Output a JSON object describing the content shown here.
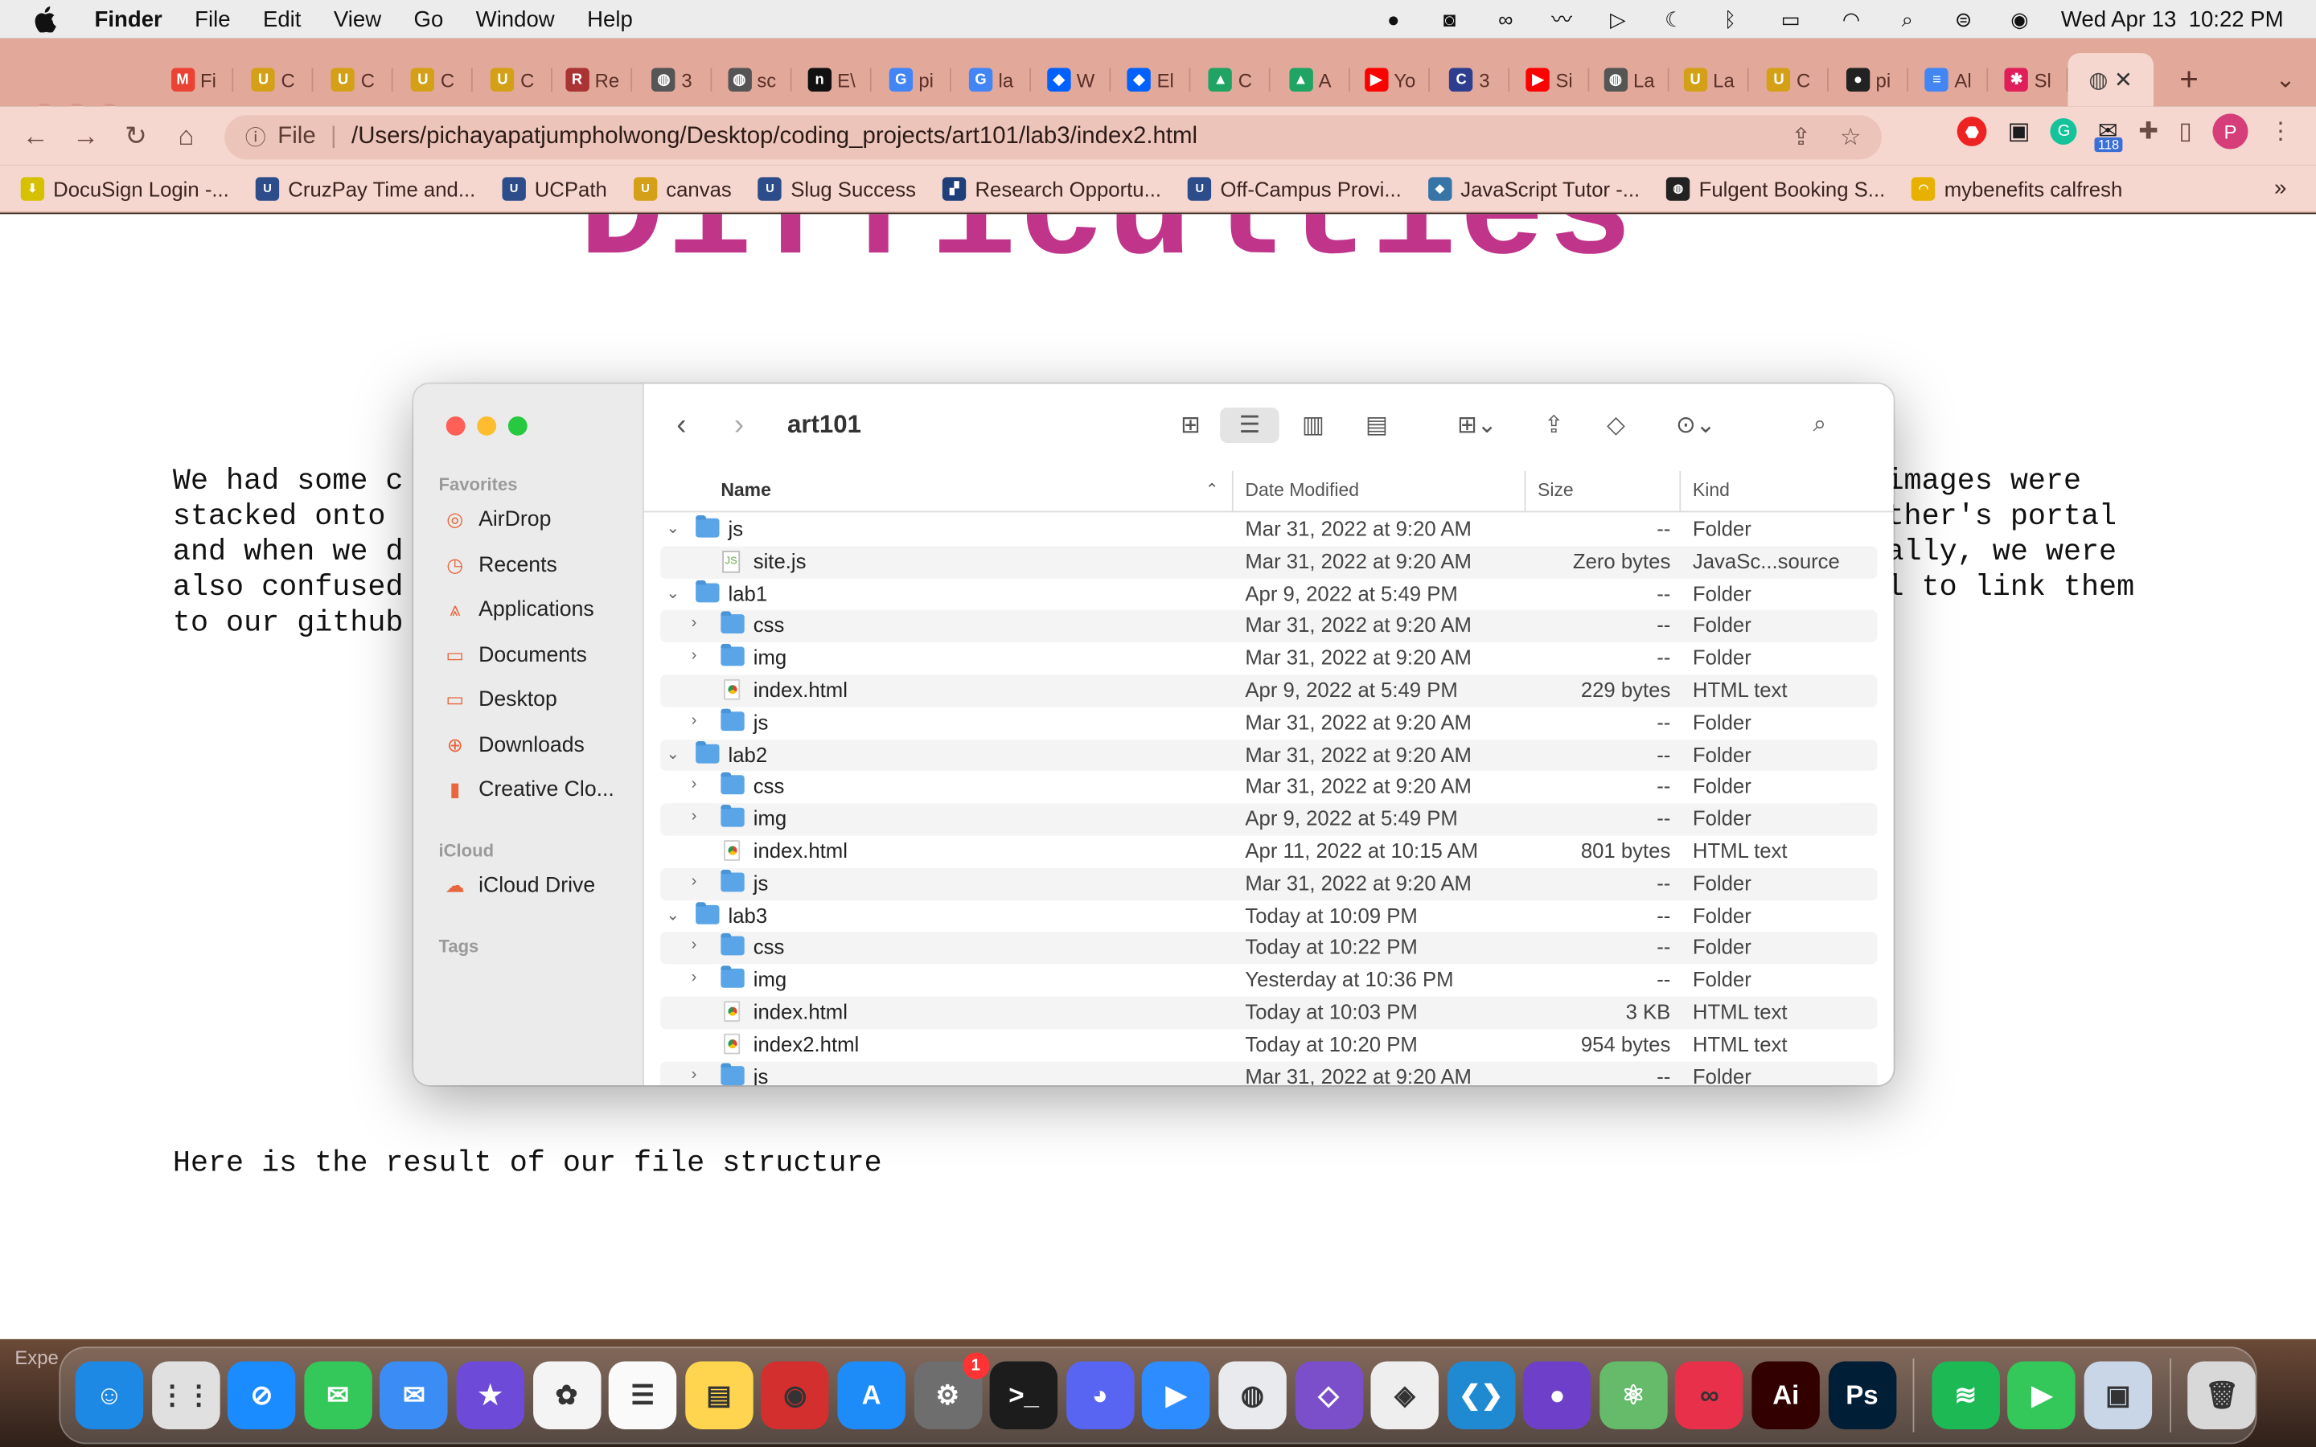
{
  "menubar": {
    "app_name": "Finder",
    "menus": [
      "File",
      "Edit",
      "View",
      "Go",
      "Window",
      "Help"
    ],
    "datetime": "Wed Apr 13  10:22 PM"
  },
  "browser": {
    "tabs": [
      {
        "fav": "M",
        "label": "Fi",
        "color": "#ea4335"
      },
      {
        "fav": "U",
        "label": "C",
        "color": "#d4a017"
      },
      {
        "fav": "U",
        "label": "C",
        "color": "#d4a017"
      },
      {
        "fav": "U",
        "label": "C",
        "color": "#d4a017"
      },
      {
        "fav": "U",
        "label": "C",
        "color": "#d4a017"
      },
      {
        "fav": "R",
        "label": "Re",
        "color": "#a33"
      },
      {
        "fav": "◍",
        "label": "3",
        "color": "#555"
      },
      {
        "fav": "◍",
        "label": "sc",
        "color": "#555"
      },
      {
        "fav": "n",
        "label": "E\\",
        "color": "#111"
      },
      {
        "fav": "G",
        "label": "pi",
        "color": "#4285f4"
      },
      {
        "fav": "G",
        "label": "la",
        "color": "#4285f4"
      },
      {
        "fav": "◆",
        "label": "W",
        "color": "#0061fe"
      },
      {
        "fav": "◆",
        "label": "El",
        "color": "#0061fe"
      },
      {
        "fav": "▲",
        "label": "C",
        "color": "#1fa463"
      },
      {
        "fav": "▲",
        "label": "A",
        "color": "#1fa463"
      },
      {
        "fav": "▶",
        "label": "Yo",
        "color": "#f00"
      },
      {
        "fav": "C",
        "label": "3",
        "color": "#2d3e8f"
      },
      {
        "fav": "▶",
        "label": "Si",
        "color": "#f00"
      },
      {
        "fav": "◍",
        "label": "La",
        "color": "#555"
      },
      {
        "fav": "U",
        "label": "La",
        "color": "#d4a017"
      },
      {
        "fav": "U",
        "label": "C",
        "color": "#d4a017"
      },
      {
        "fav": "●",
        "label": "pi",
        "color": "#222"
      },
      {
        "fav": "≡",
        "label": "Al",
        "color": "#4285f4"
      },
      {
        "fav": "✱",
        "label": "Sl",
        "color": "#e01e5a"
      }
    ],
    "active_tab_fav": "◍",
    "new_tab": "+",
    "url_scheme": "File",
    "url_path": "/Users/pichayapatjumpholwong/Desktop/coding_projects/art101/lab3/index2.html",
    "extension_badge": "118",
    "profile_initial": "P",
    "bookmarks": [
      {
        "label": "DocuSign Login -...",
        "color": "#d6c100",
        "fav": "⬇"
      },
      {
        "label": "CruzPay Time and...",
        "color": "#2d4d8a",
        "fav": "U"
      },
      {
        "label": "UCPath",
        "color": "#2d4d8a",
        "fav": "U"
      },
      {
        "label": "canvas",
        "color": "#d4a017",
        "fav": "U"
      },
      {
        "label": "Slug Success",
        "color": "#2d4d8a",
        "fav": "U"
      },
      {
        "label": "Research Opportu...",
        "color": "#1e3f7a",
        "fav": "▞"
      },
      {
        "label": "Off-Campus Provi...",
        "color": "#2d4d8a",
        "fav": "U"
      },
      {
        "label": "JavaScript Tutor -...",
        "color": "#3774a8",
        "fav": "◆"
      },
      {
        "label": "Fulgent Booking S...",
        "color": "#222",
        "fav": "◍"
      },
      {
        "label": "mybenefits calfresh",
        "color": "#e8b100",
        "fav": "◠"
      }
    ],
    "more": "»"
  },
  "page": {
    "title": "Difficulties",
    "paragraph_lines": [
      "We had some c",
      "stacked onto",
      "and when we d",
      "also confused",
      "to our github"
    ],
    "paragraph_right_lines": [
      "images were",
      "ther's portal",
      "ally, we were",
      "l to link them"
    ],
    "result_text": "Here is the result of our file structure"
  },
  "finder": {
    "title": "art101",
    "sidebar": {
      "favorites_label": "Favorites",
      "favorites": [
        {
          "label": "AirDrop",
          "icon": "airdrop-icon",
          "glyph": "◎"
        },
        {
          "label": "Recents",
          "icon": "clock-icon",
          "glyph": "◷"
        },
        {
          "label": "Applications",
          "icon": "applications-icon",
          "glyph": "⩓"
        },
        {
          "label": "Documents",
          "icon": "document-icon",
          "glyph": "▭"
        },
        {
          "label": "Desktop",
          "icon": "desktop-icon",
          "glyph": "▭"
        },
        {
          "label": "Downloads",
          "icon": "download-icon",
          "glyph": "⊕"
        },
        {
          "label": "Creative Clo...",
          "icon": "file-icon",
          "glyph": "▮"
        }
      ],
      "icloud_label": "iCloud",
      "icloud": [
        {
          "label": "iCloud Drive",
          "icon": "cloud-icon",
          "glyph": "☁"
        }
      ],
      "tags_label": "Tags"
    },
    "columns": {
      "name": "Name",
      "date": "Date Modified",
      "size": "Size",
      "kind": "Kind"
    },
    "rows": [
      {
        "depth": 0,
        "disc": "⌄",
        "type": "folder",
        "name": "js",
        "date": "Mar 31, 2022 at 9:20 AM",
        "size": "--",
        "kind": "Folder"
      },
      {
        "depth": 1,
        "disc": "",
        "type": "js",
        "name": "site.js",
        "date": "Mar 31, 2022 at 9:20 AM",
        "size": "Zero bytes",
        "kind": "JavaSc...source"
      },
      {
        "depth": 0,
        "disc": "⌄",
        "type": "folder",
        "name": "lab1",
        "date": "Apr 9, 2022 at 5:49 PM",
        "size": "--",
        "kind": "Folder"
      },
      {
        "depth": 1,
        "disc": "›",
        "type": "folder",
        "name": "css",
        "date": "Mar 31, 2022 at 9:20 AM",
        "size": "--",
        "kind": "Folder"
      },
      {
        "depth": 1,
        "disc": "›",
        "type": "folder",
        "name": "img",
        "date": "Mar 31, 2022 at 9:20 AM",
        "size": "--",
        "kind": "Folder"
      },
      {
        "depth": 1,
        "disc": "",
        "type": "html",
        "name": "index.html",
        "date": "Apr 9, 2022 at 5:49 PM",
        "size": "229 bytes",
        "kind": "HTML text"
      },
      {
        "depth": 1,
        "disc": "›",
        "type": "folder",
        "name": "js",
        "date": "Mar 31, 2022 at 9:20 AM",
        "size": "--",
        "kind": "Folder"
      },
      {
        "depth": 0,
        "disc": "⌄",
        "type": "folder",
        "name": "lab2",
        "date": "Mar 31, 2022 at 9:20 AM",
        "size": "--",
        "kind": "Folder"
      },
      {
        "depth": 1,
        "disc": "›",
        "type": "folder",
        "name": "css",
        "date": "Mar 31, 2022 at 9:20 AM",
        "size": "--",
        "kind": "Folder"
      },
      {
        "depth": 1,
        "disc": "›",
        "type": "folder",
        "name": "img",
        "date": "Apr 9, 2022 at 5:49 PM",
        "size": "--",
        "kind": "Folder"
      },
      {
        "depth": 1,
        "disc": "",
        "type": "html",
        "name": "index.html",
        "date": "Apr 11, 2022 at 10:15 AM",
        "size": "801 bytes",
        "kind": "HTML text"
      },
      {
        "depth": 1,
        "disc": "›",
        "type": "folder",
        "name": "js",
        "date": "Mar 31, 2022 at 9:20 AM",
        "size": "--",
        "kind": "Folder"
      },
      {
        "depth": 0,
        "disc": "⌄",
        "type": "folder",
        "name": "lab3",
        "date": "Today at 10:09 PM",
        "size": "--",
        "kind": "Folder"
      },
      {
        "depth": 1,
        "disc": "›",
        "type": "folder",
        "name": "css",
        "date": "Today at 10:22 PM",
        "size": "--",
        "kind": "Folder"
      },
      {
        "depth": 1,
        "disc": "›",
        "type": "folder",
        "name": "img",
        "date": "Yesterday at 10:36 PM",
        "size": "--",
        "kind": "Folder"
      },
      {
        "depth": 1,
        "disc": "",
        "type": "html",
        "name": "index.html",
        "date": "Today at 10:03 PM",
        "size": "3 KB",
        "kind": "HTML text"
      },
      {
        "depth": 1,
        "disc": "",
        "type": "html",
        "name": "index2.html",
        "date": "Today at 10:20 PM",
        "size": "954 bytes",
        "kind": "HTML text"
      },
      {
        "depth": 1,
        "disc": "›",
        "type": "folder",
        "name": "js",
        "date": "Mar 31, 2022 at 9:20 AM",
        "size": "--",
        "kind": "Folder"
      }
    ]
  },
  "dock": {
    "overlay_text": "Expe",
    "apps": [
      {
        "name": "finder-icon",
        "label": "☺",
        "bg": "#1e88e5"
      },
      {
        "name": "launchpad-icon",
        "label": "⋮⋮",
        "bg": "#e0e0e0"
      },
      {
        "name": "safari-icon",
        "label": "⊘",
        "bg": "#1a8cff"
      },
      {
        "name": "messages-icon",
        "label": "✉",
        "bg": "#34c759"
      },
      {
        "name": "mail-icon",
        "label": "✉",
        "bg": "#3b8df5"
      },
      {
        "name": "imovie-icon",
        "label": "★",
        "bg": "#6d4bd8"
      },
      {
        "name": "photos-icon",
        "label": "✿",
        "bg": "#f4f4f4"
      },
      {
        "name": "reminders-icon",
        "label": "☰",
        "bg": "#fafafa"
      },
      {
        "name": "notes-icon",
        "label": "▤",
        "bg": "#ffd54f"
      },
      {
        "name": "photo-booth-icon",
        "label": "◉",
        "bg": "#d32f2f"
      },
      {
        "name": "app-store-icon",
        "label": "A",
        "bg": "#1d8cf8"
      },
      {
        "name": "system-preferences-icon",
        "label": "⚙",
        "bg": "#6e6e6e",
        "badge": "1"
      },
      {
        "name": "terminal-icon",
        "label": ">_",
        "bg": "#1c1c1c"
      },
      {
        "name": "discord-icon",
        "label": "◕",
        "bg": "#5865f2"
      },
      {
        "name": "zoom-icon",
        "label": "▶",
        "bg": "#2d8cff"
      },
      {
        "name": "chrome-icon",
        "label": "◍",
        "bg": "#e8eaed"
      },
      {
        "name": "visual-studio-icon",
        "label": "◇",
        "bg": "#7b4fc9"
      },
      {
        "name": "unity-icon",
        "label": "◈",
        "bg": "#eeeeee"
      },
      {
        "name": "vscode-icon",
        "label": "❮❯",
        "bg": "#1f8ad2"
      },
      {
        "name": "github-desktop-icon",
        "label": "●",
        "bg": "#6e40c9"
      },
      {
        "name": "atom-icon",
        "label": "⚛",
        "bg": "#66bb6a"
      },
      {
        "name": "creative-cloud-icon",
        "label": "∞",
        "bg": "#e8304b"
      },
      {
        "name": "illustrator-icon",
        "label": "Ai",
        "bg": "#330000"
      },
      {
        "name": "photoshop-icon",
        "label": "Ps",
        "bg": "#001e36"
      }
    ],
    "apps_right": [
      {
        "name": "spotify-icon",
        "label": "≋",
        "bg": "#1db954"
      },
      {
        "name": "facetime-icon",
        "label": "▶",
        "bg": "#34c759"
      },
      {
        "name": "preview-icon",
        "label": "▣",
        "bg": "#c9d6e8"
      }
    ],
    "trash": {
      "name": "trash-icon",
      "label": "🗑",
      "bg": "#d8d8d8"
    }
  }
}
